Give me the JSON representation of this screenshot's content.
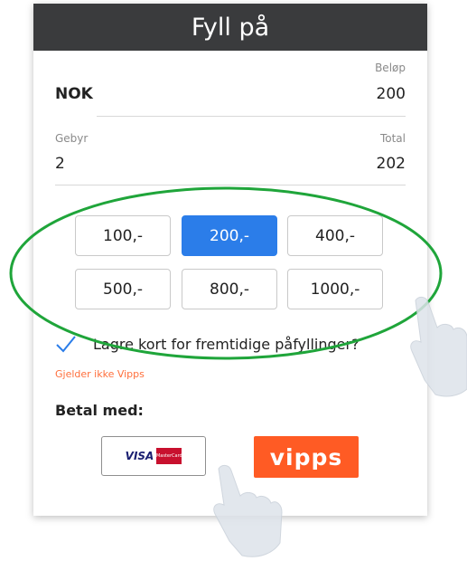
{
  "header": {
    "title": "Fyll på"
  },
  "amount": {
    "currency": "NOK",
    "label": "Beløp",
    "value": "200"
  },
  "fee": {
    "label": "Gebyr",
    "value": "2",
    "total_label": "Total",
    "total_value": "202"
  },
  "amount_options": [
    {
      "label": "100,-",
      "selected": false
    },
    {
      "label": "200,-",
      "selected": true
    },
    {
      "label": "400,-",
      "selected": false
    },
    {
      "label": "500,-",
      "selected": false
    },
    {
      "label": "800,-",
      "selected": false
    },
    {
      "label": "1000,-",
      "selected": false
    }
  ],
  "save_card": {
    "label": "Lagre kort for fremtidige påfyllinger?",
    "checked": true
  },
  "note": "Gjelder ikke Vipps",
  "payment": {
    "title": "Betal med:",
    "card_brand": "VISA",
    "mastercard_text": "MasterCard",
    "vipps_label": "vipps"
  },
  "colors": {
    "header_bg": "#3a3b3d",
    "selected_blue": "#2b7de9",
    "vipps_orange": "#ff5b24",
    "highlight_green": "#1fa53a",
    "note_orange": "#ff6f3c"
  }
}
